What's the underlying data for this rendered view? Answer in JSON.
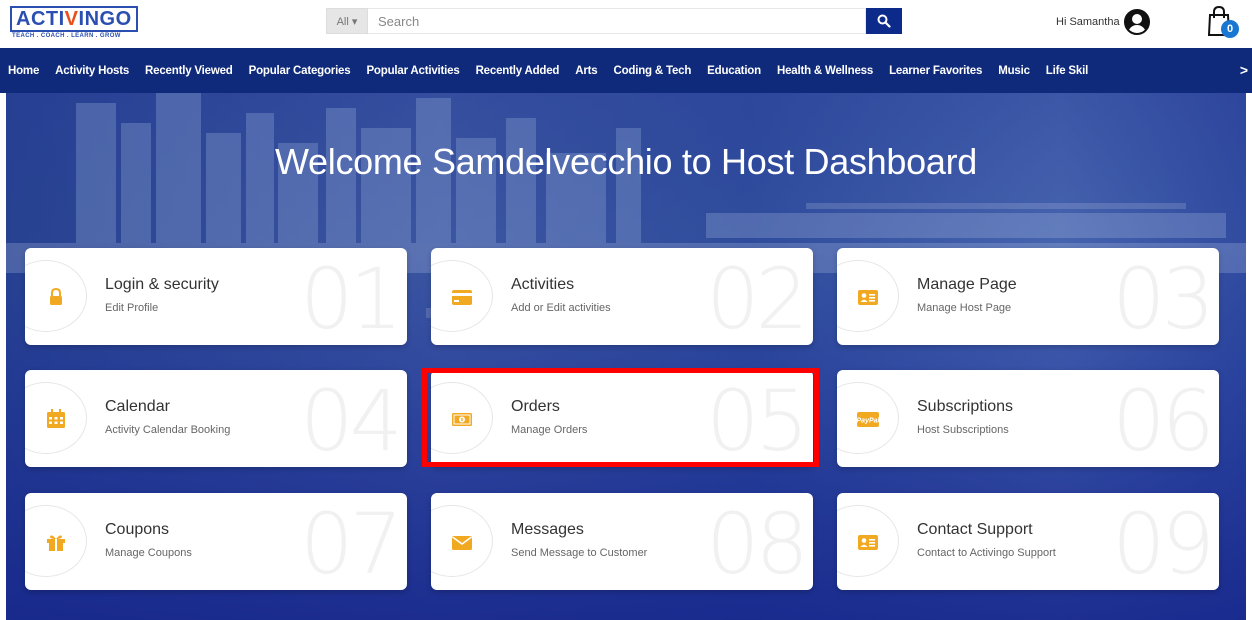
{
  "header": {
    "logo_text_main": "ACTI",
    "logo_text_accent": "V",
    "logo_text_rest": "INGO",
    "logo_tagline": "TEACH . COACH . LEARN . GROW",
    "search_category": "All ▾",
    "search_placeholder": "Search",
    "greeting": "Hi Samantha",
    "cart_count": "0"
  },
  "nav": {
    "items": [
      "Home",
      "Activity Hosts",
      "Recently Viewed",
      "Popular Categories",
      "Popular Activities",
      "Recently Added",
      "Arts",
      "Coding & Tech",
      "Education",
      "Health & Wellness",
      "Learner Favorites",
      "Music",
      "Life Skil"
    ],
    "more": ">"
  },
  "page": {
    "title": "Welcome Samdelvecchio to Host Dashboard"
  },
  "cards": [
    {
      "title": "Login & security",
      "subtitle": "Edit Profile",
      "number": "01",
      "icon": "lock-icon"
    },
    {
      "title": "Activities",
      "subtitle": "Add or Edit activities",
      "number": "02",
      "icon": "credit-card-icon"
    },
    {
      "title": "Manage Page",
      "subtitle": "Manage Host Page",
      "number": "03",
      "icon": "id-card-icon"
    },
    {
      "title": "Calendar",
      "subtitle": "Activity Calendar Booking",
      "number": "04",
      "icon": "calendar-icon"
    },
    {
      "title": "Orders",
      "subtitle": "Manage Orders",
      "number": "05",
      "icon": "money-icon"
    },
    {
      "title": "Subscriptions",
      "subtitle": "Host Subscriptions",
      "number": "06",
      "icon": "paypal-icon"
    },
    {
      "title": "Coupons",
      "subtitle": "Manage Coupons",
      "number": "07",
      "icon": "gift-icon"
    },
    {
      "title": "Messages",
      "subtitle": "Send Message to Customer",
      "number": "08",
      "icon": "envelope-icon"
    },
    {
      "title": "Contact Support",
      "subtitle": "Contact to Activingo Support",
      "number": "09",
      "icon": "id-card-icon"
    }
  ],
  "colors": {
    "brand_blue": "#2a4fb0",
    "nav_blue": "#0f2a7a",
    "icon_orange": "#f2a922",
    "highlight_red": "#ff0000"
  }
}
